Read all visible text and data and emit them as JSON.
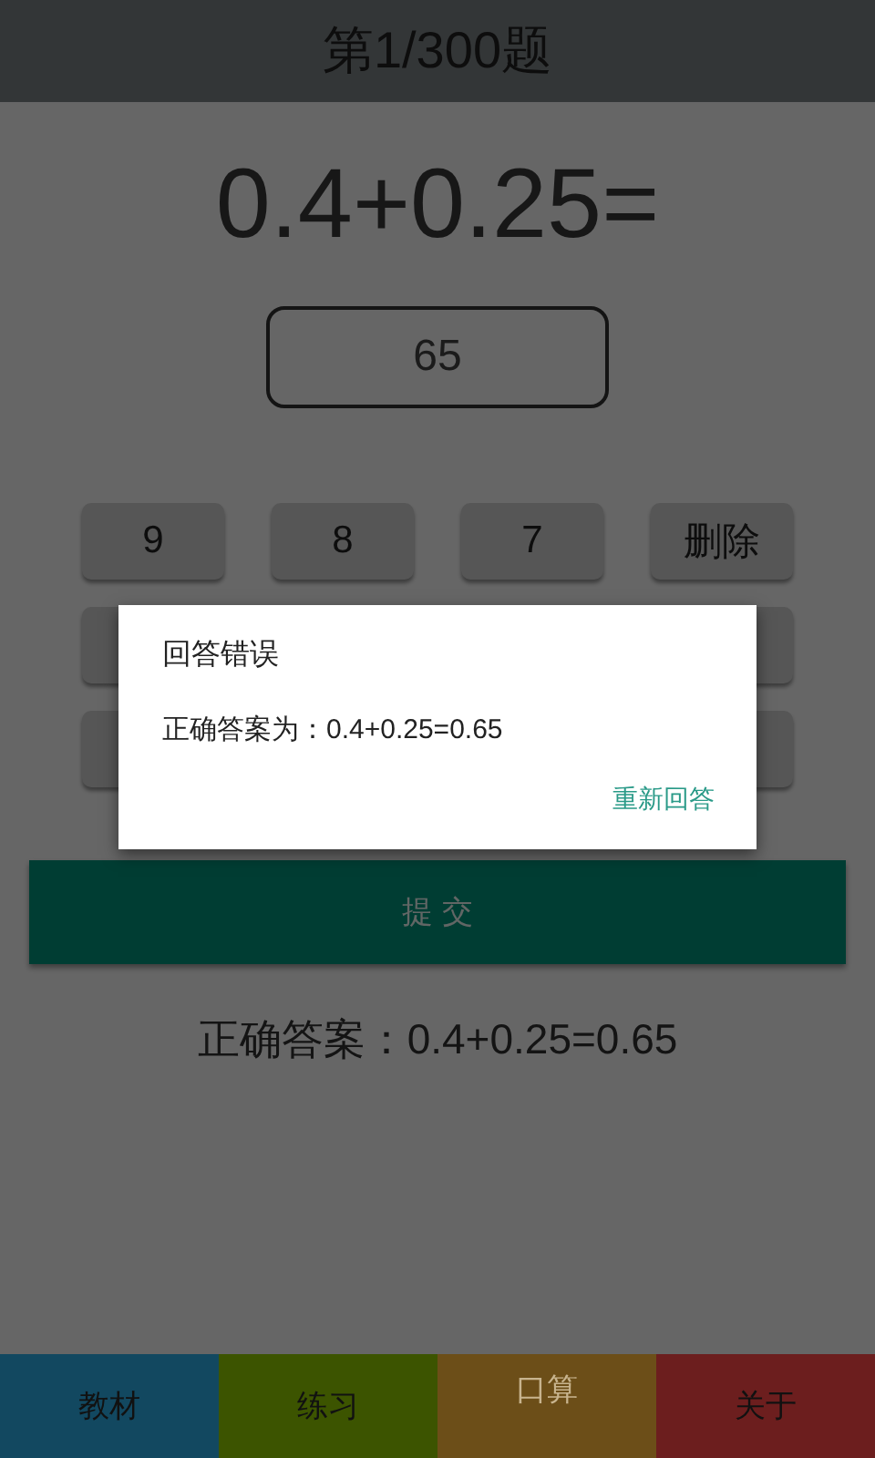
{
  "header": {
    "title": "第1/300题"
  },
  "question": "0.4+0.25=",
  "answer_field": {
    "value": "65"
  },
  "keypad": {
    "rows": [
      [
        {
          "kind": "key",
          "label": "9"
        },
        {
          "kind": "key",
          "label": "8"
        },
        {
          "kind": "key",
          "label": "7"
        },
        {
          "kind": "key",
          "label": "删除"
        }
      ],
      [
        {
          "kind": "covered"
        },
        {
          "kind": "hidden"
        },
        {
          "kind": "hidden"
        },
        {
          "kind": "covered"
        }
      ],
      [
        {
          "kind": "covered"
        },
        {
          "kind": "hidden"
        },
        {
          "kind": "hidden"
        },
        {
          "kind": "covered"
        }
      ]
    ]
  },
  "submit_button": "提 交",
  "correct_answer": "正确答案：0.4+0.25=0.65",
  "tabs": [
    {
      "label": "教材",
      "selected": false,
      "color": "#124860"
    },
    {
      "label": "练习",
      "selected": false,
      "color": "#3c5400"
    },
    {
      "label": "口算",
      "selected": true,
      "color": "#6c4e18"
    },
    {
      "label": "关于",
      "selected": false,
      "color": "#6c1e1e"
    }
  ],
  "dialog": {
    "title": "回答错误",
    "message": "正确答案为：0.4+0.25=0.65",
    "button": "重新回答"
  }
}
